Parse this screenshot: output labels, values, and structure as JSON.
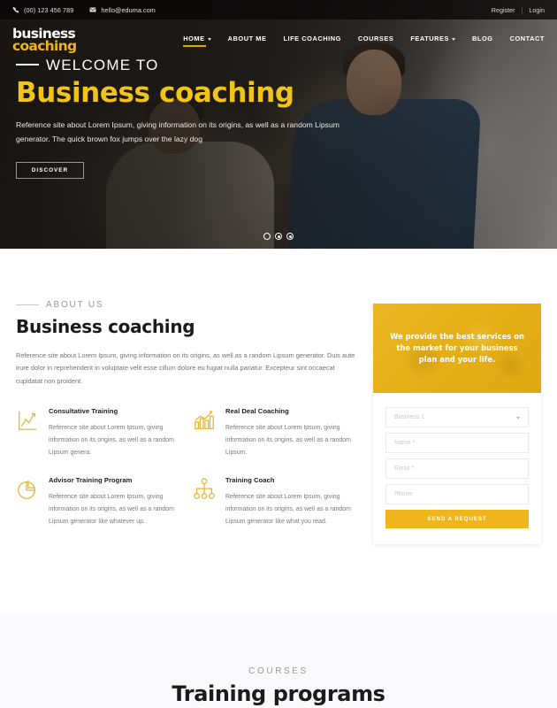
{
  "topbar": {
    "phone": "(00) 123 456 789",
    "email": "hello@eduma.com",
    "phone_icon": "phone-icon",
    "email_icon": "envelope-icon",
    "register": "Register",
    "login": "Login",
    "separator": "|"
  },
  "brand": {
    "line1": "business",
    "line2": "coaching"
  },
  "nav": {
    "items": [
      {
        "label": "HOME",
        "has_caret": true,
        "active": true
      },
      {
        "label": "ABOUT ME",
        "has_caret": false,
        "active": false
      },
      {
        "label": "LIFE COACHING",
        "has_caret": false,
        "active": false
      },
      {
        "label": "COURSES",
        "has_caret": false,
        "active": false
      },
      {
        "label": "FEATURES",
        "has_caret": true,
        "active": false
      },
      {
        "label": "BLOG",
        "has_caret": false,
        "active": false
      },
      {
        "label": "CONTACT",
        "has_caret": false,
        "active": false
      }
    ]
  },
  "hero": {
    "welcome": "WELCOME TO",
    "title": "Business coaching",
    "description": "Reference site about Lorem Ipsum, giving information on its origins, as well as a random Lipsum generator. The quick brown fox jumps over the lazy dog",
    "cta": "DISCOVER",
    "slides": 3,
    "active_slide": 1
  },
  "about": {
    "eyebrow": "ABOUT US",
    "title": "Business coaching",
    "description": "Reference site about Lorem Ipsum, giving information on its origins, as well as a random Lipsum generator. Duis aute irure dolor in reprehenderit in voluptate velit esse cillum dolore eu fugiat nulla pariatur. Excepteur sint occaecat cupidatat non proident.",
    "features": [
      {
        "icon": "line-chart-icon",
        "title": "Consultative Training",
        "description": "Reference site about Lorem Ipsum, giving information on its origins, as well as a random Lipsum genera."
      },
      {
        "icon": "bar-chart-star-icon",
        "title": "Real Deal Coaching",
        "description": "Reference site about Lorem Ipsum, giving information on its origins, as well as a random Lipsum."
      },
      {
        "icon": "pie-chart-icon",
        "title": "Advisor Training Program",
        "description": "Reference site about Lorem Ipsum, giving information on its origins, as well as a random Lipsum generator like whatever up."
      },
      {
        "icon": "org-chart-icon",
        "title": "Training Coach",
        "description": "Reference site about Lorem Ipsum, giving information on its origins, as well as a random Lipsum generator like what you read."
      }
    ]
  },
  "side_card": {
    "banner_text": "We provide the best services on the market for your business plan and your life.",
    "form": {
      "business_value": "Business 1",
      "name_placeholder": "Name *",
      "email_placeholder": "Email *",
      "phone_placeholder": "Phone",
      "submit_label": "SEND A REQUEST"
    }
  },
  "courses": {
    "eyebrow": "COURSES",
    "title": "Training programs"
  },
  "colors": {
    "accent_yellow": "#eeb51c",
    "hero_title_yellow": "#f0c419",
    "dark_text": "#1c1b1a",
    "muted_text": "#7d7a78",
    "section_bg": "#f9f8fa"
  }
}
